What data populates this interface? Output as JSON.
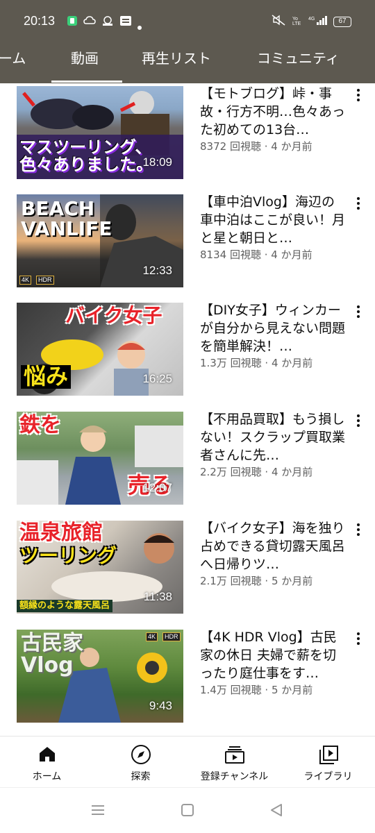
{
  "status_bar": {
    "time": "20:13",
    "battery": "67",
    "icons": [
      "app-icon",
      "cloud-icon",
      "app-icon",
      "app-icon",
      "dot",
      "mute-icon",
      "volte-icon",
      "signal-icon",
      "battery-icon"
    ]
  },
  "tabs": [
    {
      "label": "ホーム",
      "visible_text": "ーム",
      "active": false
    },
    {
      "label": "動画",
      "active": true
    },
    {
      "label": "再生リスト",
      "active": false
    },
    {
      "label": "コミュニティ",
      "active": false
    }
  ],
  "videos": [
    {
      "title": "【モトブログ】峠・事故・行方不明…色々あった初めての13台…",
      "views": "8372 回視聴",
      "age": "4 か月前",
      "duration": "18:09",
      "thumb_text": "マスツーリング、色々ありました。"
    },
    {
      "title": "【車中泊Vlog】海辺の車中泊はここが良い！月と星と朝日と…",
      "views": "8134 回視聴",
      "age": "4 か月前",
      "duration": "12:33",
      "thumb_text": "BEACH VANLIFE",
      "badges": [
        "4K",
        "HDR"
      ]
    },
    {
      "title": "【DIY女子】ウィンカーが自分から見えない問題を簡単解決！…",
      "views": "1.3万 回視聴",
      "age": "4 か月前",
      "duration": "16:25",
      "thumb_text_1": "バイク女子",
      "thumb_text_2": "悩み"
    },
    {
      "title": "【不用品買取】もう損しない！スクラップ買取業者さんに先…",
      "views": "2.2万 回視聴",
      "age": "4 か月前",
      "duration": "12:07",
      "thumb_text_1": "鉄を",
      "thumb_text_2": "売る"
    },
    {
      "title": "【バイク女子】海を独り占めできる貸切露天風呂へ日帰りツ…",
      "views": "2.1万 回視聴",
      "age": "5 か月前",
      "duration": "11:38",
      "thumb_text_1": "温泉旅館",
      "thumb_text_2": "ツーリング",
      "thumb_text_3": "額縁のような露天風呂"
    },
    {
      "title": "【4K HDR Vlog】古民家の休日 夫婦で薪を切ったり庭仕事をす…",
      "views": "1.4万 回視聴",
      "age": "5 か月前",
      "duration": "9:43",
      "thumb_text": "古民家 Vlog",
      "badges": [
        "4K",
        "HDR"
      ]
    }
  ],
  "meta_separator": " · ",
  "bottom_nav": [
    {
      "label": "ホーム",
      "icon": "home-icon",
      "active": true
    },
    {
      "label": "探索",
      "icon": "compass-icon"
    },
    {
      "label": "登録チャンネル",
      "icon": "subscriptions-icon"
    },
    {
      "label": "ライブラリ",
      "icon": "library-icon"
    }
  ],
  "colors": {
    "header": "#5d5950",
    "text_primary": "#0f0f0f",
    "text_secondary": "#606060"
  }
}
